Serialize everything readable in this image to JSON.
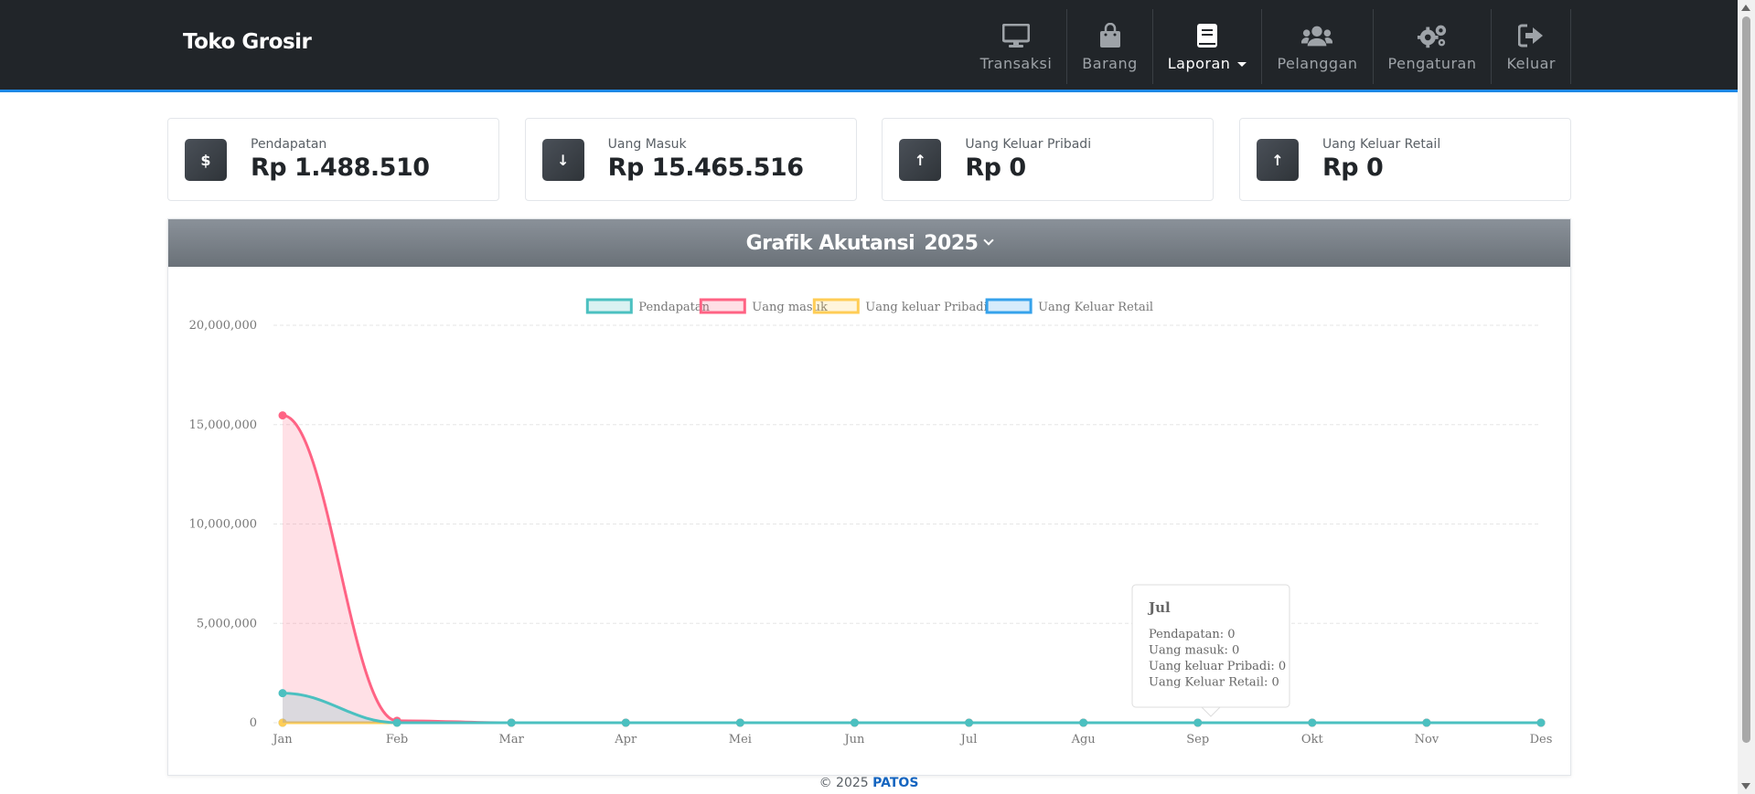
{
  "navbar": {
    "brand": "Toko Grosir",
    "items": [
      {
        "label": "Transaksi",
        "icon": "desktop-icon"
      },
      {
        "label": "Barang",
        "icon": "shopping-bag-icon"
      },
      {
        "label": "Laporan",
        "icon": "book-icon",
        "active": true,
        "dropdown": true
      },
      {
        "label": "Pelanggan",
        "icon": "users-icon"
      },
      {
        "label": "Pengaturan",
        "icon": "gears-icon"
      },
      {
        "label": "Keluar",
        "icon": "sign-out-icon"
      }
    ]
  },
  "cards": [
    {
      "label": "Pendapatan",
      "value": "Rp 1.488.510",
      "icon": "dollar-icon",
      "glyph": "$"
    },
    {
      "label": "Uang Masuk",
      "value": "Rp 15.465.516",
      "icon": "arrow-down-icon",
      "glyph": "↓"
    },
    {
      "label": "Uang Keluar Pribadi",
      "value": "Rp 0",
      "icon": "arrow-up-icon",
      "glyph": "↑"
    },
    {
      "label": "Uang Keluar Retail",
      "value": "Rp 0",
      "icon": "arrow-up-icon",
      "glyph": "↑"
    }
  ],
  "panel": {
    "title": "Grafik Akutansi",
    "year": "2025"
  },
  "chart_data": {
    "type": "area",
    "categories": [
      "Jan",
      "Feb",
      "Mar",
      "Apr",
      "Mei",
      "Jun",
      "Jul",
      "Agu",
      "Sep",
      "Okt",
      "Nov",
      "Des"
    ],
    "ylim": [
      0,
      20000000
    ],
    "yticks": [
      "0",
      "5,000,000",
      "10,000,000",
      "15,000,000",
      "20,000,000"
    ],
    "grid": true,
    "legend_position": "top",
    "series": [
      {
        "name": "Pendapatan",
        "color": "#4bc0c0",
        "fill": "rgba(75,192,192,0.2)",
        "values": [
          1488510,
          0,
          0,
          0,
          0,
          0,
          0,
          0,
          0,
          0,
          0,
          0
        ]
      },
      {
        "name": "Uang masuk",
        "color": "#ff6384",
        "fill": "rgba(255,99,132,0.2)",
        "values": [
          15465516,
          100000,
          0,
          0,
          0,
          0,
          0,
          0,
          0,
          0,
          0,
          0
        ]
      },
      {
        "name": "Uang keluar Pribadi",
        "color": "#ffcd56",
        "fill": "rgba(255,205,86,0.2)",
        "values": [
          0,
          0,
          0,
          0,
          0,
          0,
          0,
          0,
          0,
          0,
          0,
          0
        ]
      },
      {
        "name": "Uang Keluar Retail",
        "color": "#36a2eb",
        "fill": "rgba(54,162,235,0.2)",
        "values": [
          0,
          0,
          0,
          0,
          0,
          0,
          0,
          0,
          0,
          0,
          0,
          0
        ]
      }
    ],
    "tooltip": {
      "title": "Jul",
      "lines": [
        "Pendapatan: 0",
        "Uang masuk: 0",
        "Uang keluar Pribadi: 0",
        "Uang Keluar Retail: 0"
      ]
    }
  },
  "footer": {
    "text": "© 2025",
    "link": "PATOS"
  }
}
